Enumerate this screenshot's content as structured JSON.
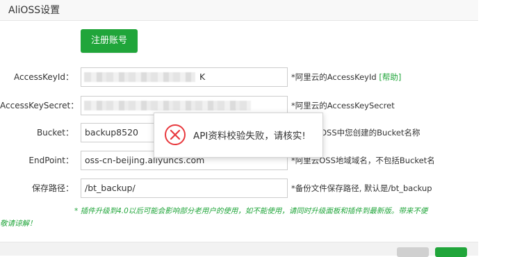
{
  "dialog": {
    "title": "AliOSS设置",
    "register_button": "注册账号"
  },
  "form": {
    "access_key_id": {
      "label": "AccessKeyId：",
      "value_tail": "K",
      "hint": "*阿里云的AccessKeyId",
      "help_link": "[帮助]"
    },
    "access_key_secret": {
      "label": "AccessKeySecret：",
      "hint": "*阿里云的AccessKeySecret"
    },
    "bucket": {
      "label": "Bucket：",
      "value": "backup8520",
      "hint": "OSS中您创建的Bucket名称"
    },
    "endpoint": {
      "label": "EndPoint：",
      "value": "oss-cn-beijing.aliyuncs.com",
      "hint": "*阿里云OSS地域域名，不包括Bucket名"
    },
    "save_path": {
      "label": "保存路径：",
      "value": "/bt_backup/",
      "hint": "*备份文件保存路径, 默认是/bt_backup"
    }
  },
  "notice": {
    "line1": "* 插件升级到4.0以后可能会影响部分老用户的使用，如不能使用，请同时升级面板和插件到最新版。带来不便",
    "line2": "敬请谅解！"
  },
  "toast": {
    "message": "API资料校验失败，请核实!",
    "icon": "error-circle-icon",
    "color": "#e8383d"
  },
  "colors": {
    "accent": "#20a53a"
  }
}
